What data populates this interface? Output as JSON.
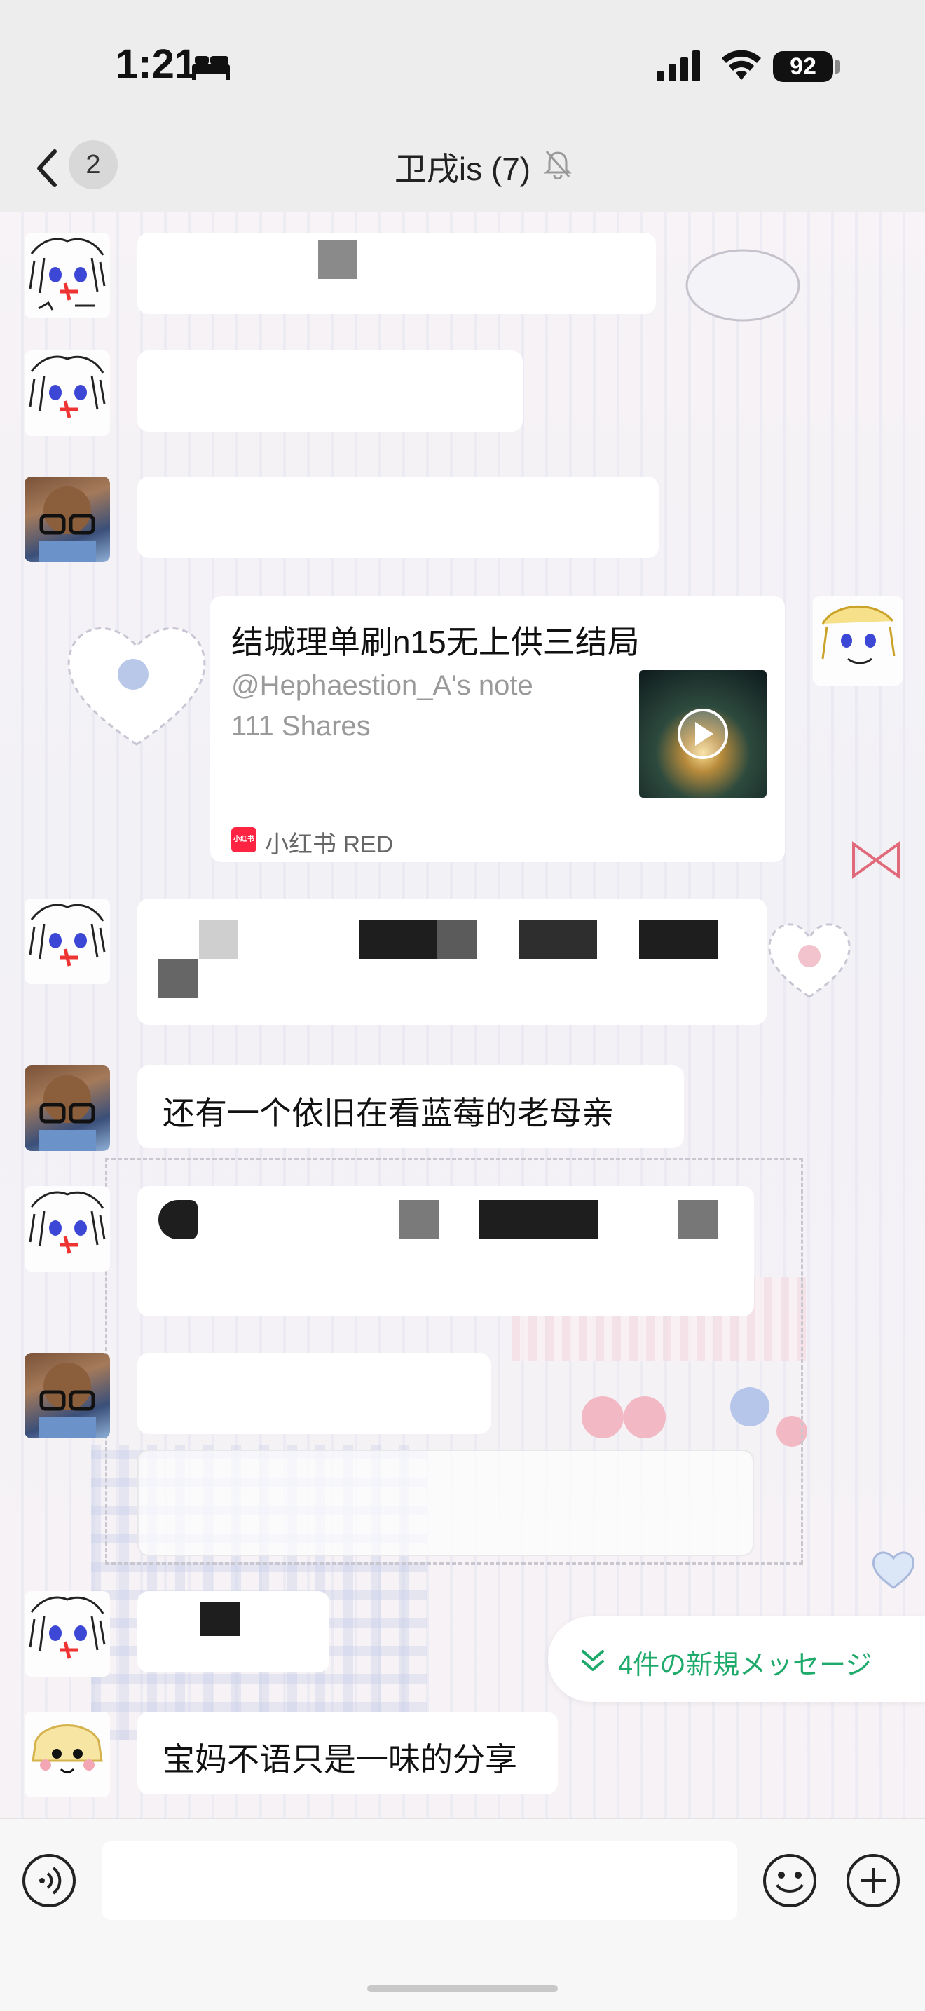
{
  "status_bar": {
    "time": "1:21",
    "battery": "92"
  },
  "nav": {
    "unread_count": "2",
    "title": "卫戌is (7)"
  },
  "messages": {
    "m6_text": "还有一个依旧在看蓝莓的老母亲",
    "m13_text": "宝妈不语只是一味的分享"
  },
  "share_card": {
    "title": "结城理单刷n15无上供三结局",
    "author": "@Hephaestion_A's note",
    "shares": "111 Shares",
    "source": "小红书 RED",
    "source_icon_text": "小红书"
  },
  "new_messages_pill": {
    "label": "4件の新規メッセージ"
  },
  "input": {
    "placeholder": ""
  },
  "icons": [
    "back-chevron-icon",
    "mute-bell-icon",
    "more-icon",
    "voice-icon",
    "emoji-icon",
    "plus-icon",
    "play-icon",
    "chevron-double-down-icon"
  ]
}
